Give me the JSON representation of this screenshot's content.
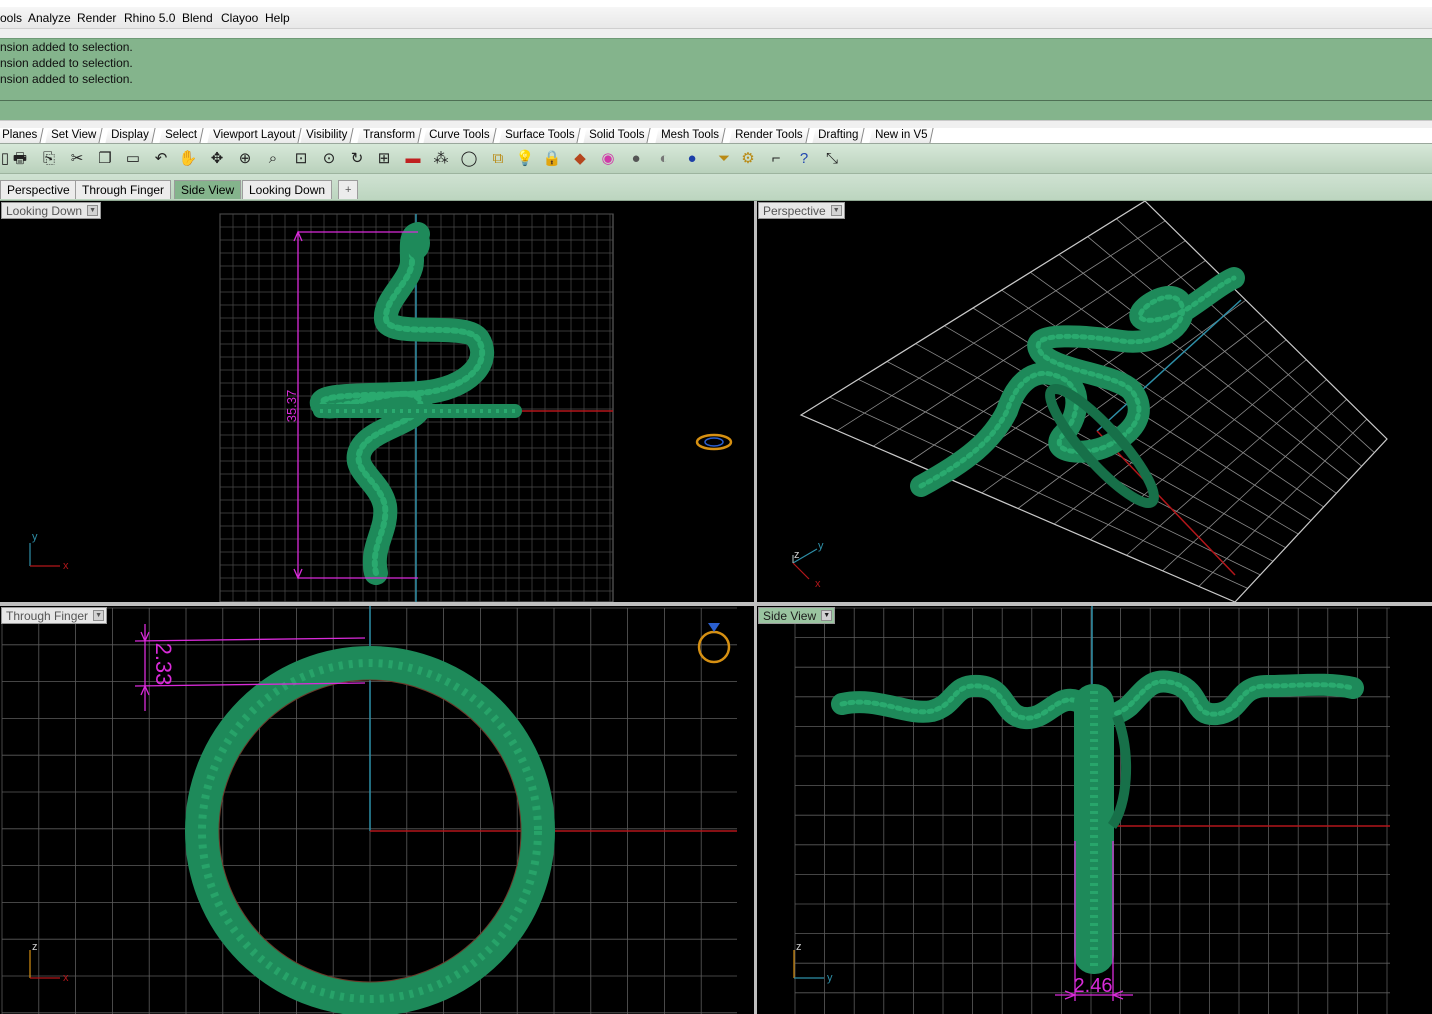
{
  "menu": [
    "ools",
    "Analyze",
    "Render",
    "Rhino 5.0",
    "Blend",
    "Clayoo",
    "Help"
  ],
  "history": [
    "nsion added to selection.",
    "nsion added to selection.",
    "nsion added to selection."
  ],
  "toolbar_tabs": [
    "Planes",
    "Set View",
    "Display",
    "Select",
    "Viewport Layout",
    "Visibility",
    "Transform",
    "Curve Tools",
    "Surface Tools",
    "Solid Tools",
    "Mesh Tools",
    "Render Tools",
    "Drafting",
    "New in V5"
  ],
  "tools": [
    "new-icon",
    "print-icon",
    "paste-icon",
    "cut-icon",
    "copy-icon",
    "clipboard-icon",
    "undo-icon",
    "pan-icon",
    "move-icon",
    "zoom-in-icon",
    "zoom-window-icon",
    "zoom-extents-icon",
    "zoom-selected-icon",
    "rotate-view-icon",
    "four-views-icon",
    "car-icon",
    "grid-icon",
    "circle-icon",
    "snap-icon",
    "light-icon",
    "lock-icon",
    "material-icon",
    "color-wheel-icon",
    "shade-icon",
    "render-sphere-icon",
    "blue-sphere-icon",
    "select-filter-icon",
    "gear-icon",
    "dimension-icon",
    "help-icon",
    "arrows-icon"
  ],
  "viewport_tabs": [
    "Perspective",
    "Through Finger",
    "Side View",
    "Looking Down",
    "+"
  ],
  "active_viewport_tab": "Side View",
  "viewports": {
    "top_left": {
      "label": "Looking Down",
      "dimension": "35.37",
      "axis_y": "y",
      "axis_x": "x"
    },
    "top_right": {
      "label": "Perspective",
      "axis_z": "z",
      "axis_y": "y",
      "axis_x": "x"
    },
    "bottom_left": {
      "label": "Through Finger",
      "dimension": "2.33",
      "axis_z": "z",
      "axis_x": "x"
    },
    "bottom_right": {
      "label": "Side View",
      "dimension": "2.46",
      "axis_z": "z",
      "axis_y": "y"
    }
  },
  "colors": {
    "command_green": "#84b48c",
    "model_green": "#1e8a5a",
    "dimension": "#d92bd9",
    "x_axis": "#b3161a",
    "y_axis": "#2e8fa8",
    "grid": "#7a7a7a",
    "viewport_bg": "#000000"
  }
}
